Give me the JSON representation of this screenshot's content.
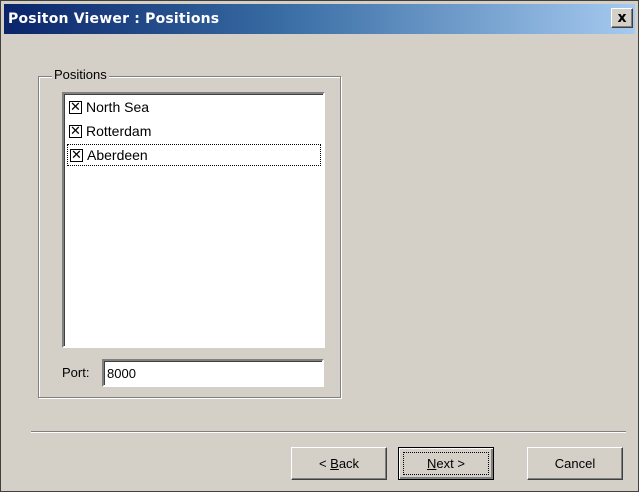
{
  "window": {
    "title": "Positon Viewer : Positions",
    "close_label": "x"
  },
  "positions_group": {
    "label": "Positions",
    "items": [
      {
        "label": "North Sea",
        "checked": true,
        "check_glyph": "✕"
      },
      {
        "label": "Rotterdam",
        "checked": true,
        "check_glyph": "✕"
      },
      {
        "label": "Aberdeen",
        "checked": true,
        "check_glyph": "✕"
      }
    ],
    "port_label": "Port:",
    "port_value": "8000"
  },
  "buttons": {
    "back_prefix": "< ",
    "back_accel": "B",
    "back_rest": "ack",
    "next_accel": "N",
    "next_rest": "ext >",
    "cancel": "Cancel"
  }
}
